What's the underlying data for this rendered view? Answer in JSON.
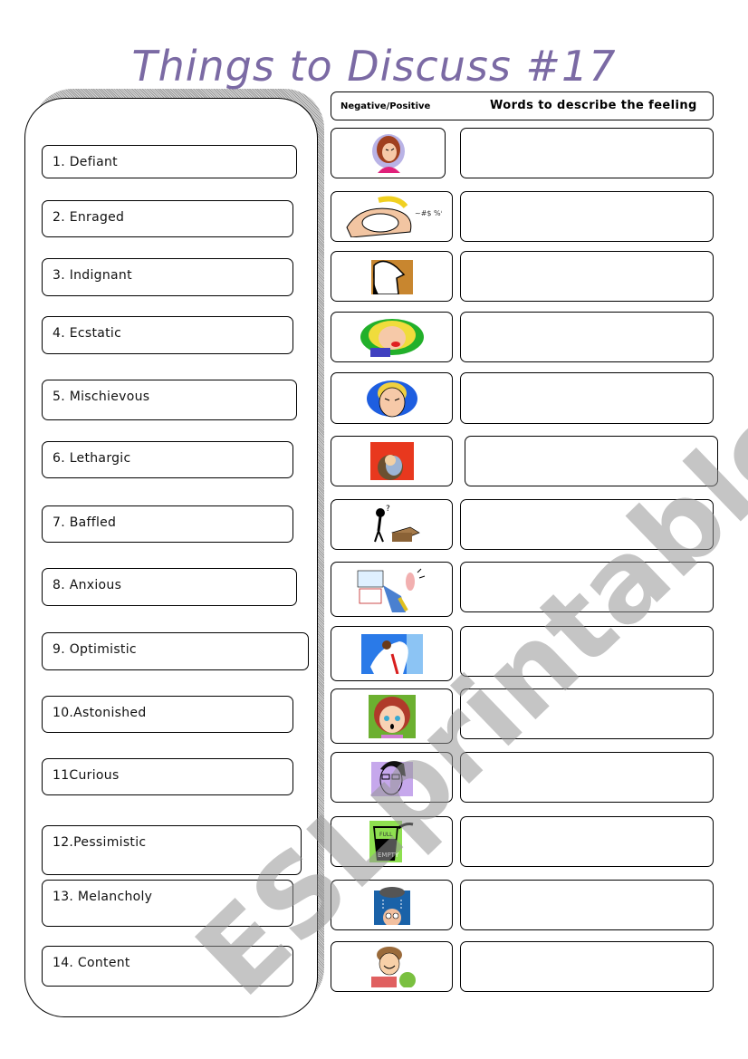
{
  "title": "Things to Discuss #17",
  "header": {
    "left_label": "Negative/Positive",
    "right_label": "Words to describe the feeling"
  },
  "words": [
    {
      "number": "1.",
      "label": "Defiant",
      "display": "1. Defiant",
      "picture": "angry-woman-icon"
    },
    {
      "number": "2.",
      "label": "Enraged",
      "display": "2. Enraged",
      "picture": "shouting-man-icon"
    },
    {
      "number": "3.",
      "label": "Indignant",
      "display": "3. Indignant",
      "picture": "offended-man-icon"
    },
    {
      "number": "4.",
      "label": "Ecstatic",
      "display": "4. Ecstatic",
      "picture": "happy-woman-icon"
    },
    {
      "number": "5.",
      "label": "Mischievous",
      "display": "5. Mischievous",
      "picture": "scheming-man-icon"
    },
    {
      "number": "6.",
      "label": "Lethargic",
      "display": "6. Lethargic",
      "picture": "tired-person-icon"
    },
    {
      "number": "7.",
      "label": "Baffled",
      "display": "7. Baffled",
      "picture": "confused-figure-icon"
    },
    {
      "number": "8.",
      "label": "Anxious",
      "display": "8. Anxious",
      "picture": "stressed-businessman-icon"
    },
    {
      "number": "9.",
      "label": "Optimistic",
      "display": "9. Optimistic",
      "picture": "looking-ahead-man-icon"
    },
    {
      "number": "10.",
      "label": "Astonished",
      "display": "10.Astonished",
      "picture": "surprised-girl-icon"
    },
    {
      "number": "11",
      "label": "Curious",
      "display": "11Curious",
      "picture": "curious-man-glasses-icon"
    },
    {
      "number": "12.",
      "label": "Pessimistic",
      "display": "12.Pessimistic",
      "picture": "half-empty-glass-icon"
    },
    {
      "number": "13.",
      "label": "Melancholy",
      "display": "13. Melancholy",
      "picture": "rain-cloud-man-icon"
    },
    {
      "number": "14.",
      "label": "Content",
      "display": "14. Content",
      "picture": "smiling-boy-reading-icon"
    }
  ],
  "watermark": "ESLprintables.com",
  "colors": {
    "title": "#7b6aa4",
    "border": "#000000",
    "watermark": "#969696"
  }
}
